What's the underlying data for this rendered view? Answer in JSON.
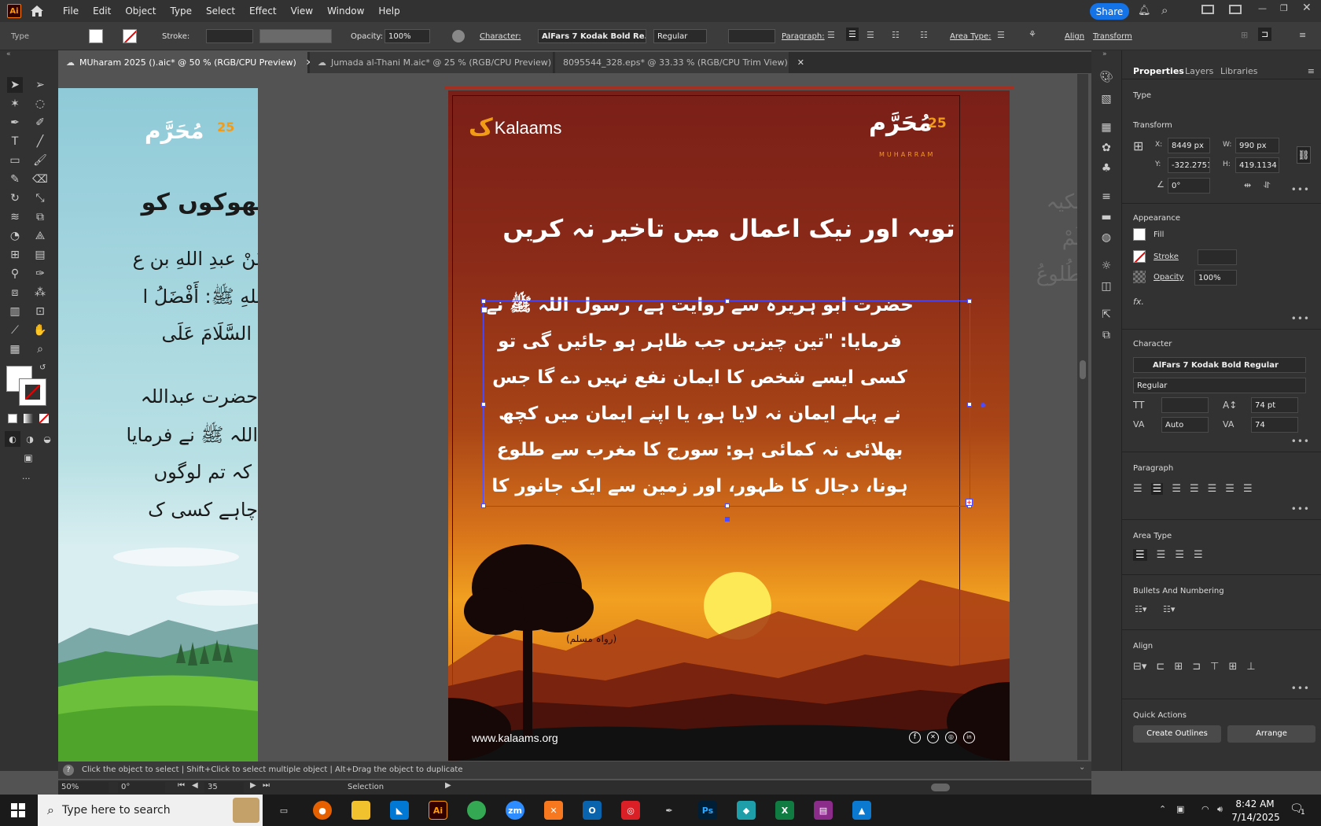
{
  "menu": {
    "items": [
      "File",
      "Edit",
      "Object",
      "Type",
      "Select",
      "Effect",
      "View",
      "Window",
      "Help"
    ],
    "share_label": "Share",
    "logo_text": "Ai"
  },
  "control_bar": {
    "mode_label": "Type",
    "stroke_label": "Stroke:",
    "opacity_label": "Opacity:",
    "opacity_value": "100%",
    "character_label": "Character:",
    "font_value": "AlFars 7 Kodak Bold Re...",
    "style_value": "Regular",
    "paragraph_label": "Paragraph:",
    "area_type_label": "Area Type:",
    "align_label": "Align",
    "transform_label": "Transform"
  },
  "tabs": [
    {
      "label": "MUharam 2025 ().aic* @ 50 % (RGB/CPU Preview)"
    },
    {
      "label": "Jumada al-Thani M.aic* @ 25 % (RGB/CPU Preview)"
    },
    {
      "label": "8095544_328.eps* @ 33.33 % (RGB/CPU Trim View)"
    }
  ],
  "left_artboard": {
    "badge_number": "25",
    "heading": "بھوکوں کو",
    "lines": [
      "عَنْ عبدِ اللهِ بن ع",
      "اللهِ ﷺ: أَفْضَلُ ا",
      "السَّلَامَ عَلَى",
      "حضرت عبداللہ",
      "اللہ ﷺ نے فرمایا",
      "کہ تم لوگوں",
      "چاہے کسی ک"
    ]
  },
  "artboard": {
    "brand": "Kalaams",
    "badge_number": "25",
    "badge_sub": "MUHARRAM",
    "title": "توبہ اور نیک اعمال میں تاخیر نہ کریں",
    "body_lines": [
      "حضرت ابو ہریرہ سے روایت ہے، رسول اللہ ﷺ نے",
      "فرمایا: \"تین چیزیں جب ظاہر ہو جائیں گی تو",
      "کسی ایسے شخص کا ایمان نفع نہیں دے گا جس",
      "نے پہلے ایمان نہ لایا ہو، یا اپنے ایمان میں کچھ",
      "بھلائی نہ کمائی ہو: سورج کا مغرب سے طلوع",
      "ہونا، دجال کا ظہور، اور زمین سے ایک جانور کا"
    ],
    "source": "(رواہ مسلم)",
    "website": "www.kalaams.org"
  },
  "right_faded_text": [
    "لکیہ",
    "لَمْ",
    "طُلوعُ"
  ],
  "panel": {
    "tabs": [
      "Properties",
      "Layers",
      "Libraries"
    ],
    "type_label": "Type",
    "transform_label": "Transform",
    "x_label": "X:",
    "x_value": "8449 px",
    "y_label": "Y:",
    "y_value": "-322.2751 p",
    "w_label": "W:",
    "w_value": "990 px",
    "h_label": "H:",
    "h_value": "419.1134 p",
    "angle_value": "0°",
    "appearance_label": "Appearance",
    "fill_label": "Fill",
    "stroke_label": "Stroke",
    "opacity_label": "Opacity",
    "opacity_value": "100%",
    "fx_label": "fx.",
    "character_label": "Character",
    "font_value": "AlFars 7 Kodak Bold Regular",
    "style_value": "Regular",
    "leading_value": "74 pt",
    "kerning_value": "Auto",
    "tracking_value": "74",
    "paragraph_label": "Paragraph",
    "area_type_label": "Area Type",
    "bullets_label": "Bullets And Numbering",
    "align_label": "Align",
    "quick_actions_label": "Quick Actions",
    "create_outlines_label": "Create Outlines",
    "arrange_label": "Arrange"
  },
  "status": {
    "hint": "Click the object to select  |  Shift+Click to select multiple object  |  Alt+Drag the object to duplicate",
    "zoom": "50%",
    "rotation": "0°",
    "page": "35",
    "tool": "Selection"
  },
  "taskbar": {
    "search_placeholder": "Type here to search",
    "time": "8:42 AM",
    "date": "7/14/2025",
    "notification_count": "1"
  },
  "colors": {
    "accent": "#1473e6",
    "selection": "#4b4bff",
    "artboard_top": "#7a1f18",
    "sun": "#fde856"
  }
}
